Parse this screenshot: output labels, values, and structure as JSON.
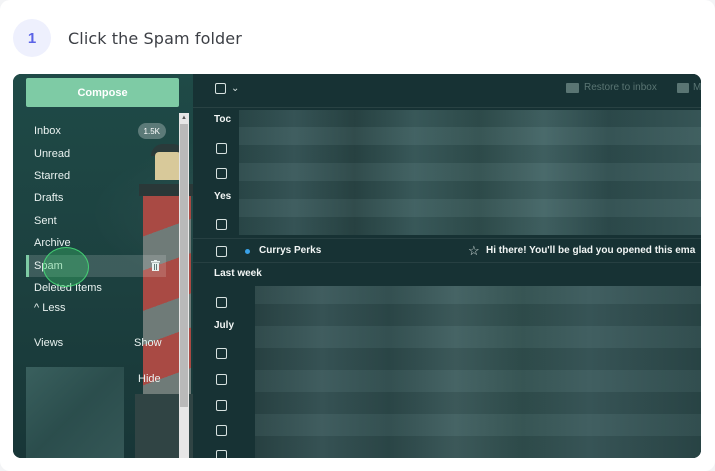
{
  "step": {
    "number": "1",
    "instruction": "Click the Spam folder"
  },
  "sidebar": {
    "compose_label": "Compose",
    "folders": [
      {
        "label": "Inbox",
        "count": "1.5K"
      },
      {
        "label": "Unread"
      },
      {
        "label": "Starred"
      },
      {
        "label": "Drafts"
      },
      {
        "label": "Sent"
      },
      {
        "label": "Archive"
      },
      {
        "label": "Spam",
        "active": true
      },
      {
        "label": "Deleted Items"
      }
    ],
    "less_label": "^ Less",
    "views_label": "Views",
    "show_label": "Show",
    "hide_label": "Hide"
  },
  "toolbar": {
    "restore_label": "Restore to inbox",
    "move_label": "M"
  },
  "list": {
    "groups": [
      "Toc",
      "Yes",
      "Last week",
      "July"
    ],
    "message": {
      "sender": "Currys Perks",
      "subject": "Hi there! You'll be glad you opened this ema"
    }
  },
  "colors": {
    "accent": "#7ecba5",
    "unread_dot": "#3aa2e8",
    "badge": "#5b63e6"
  }
}
